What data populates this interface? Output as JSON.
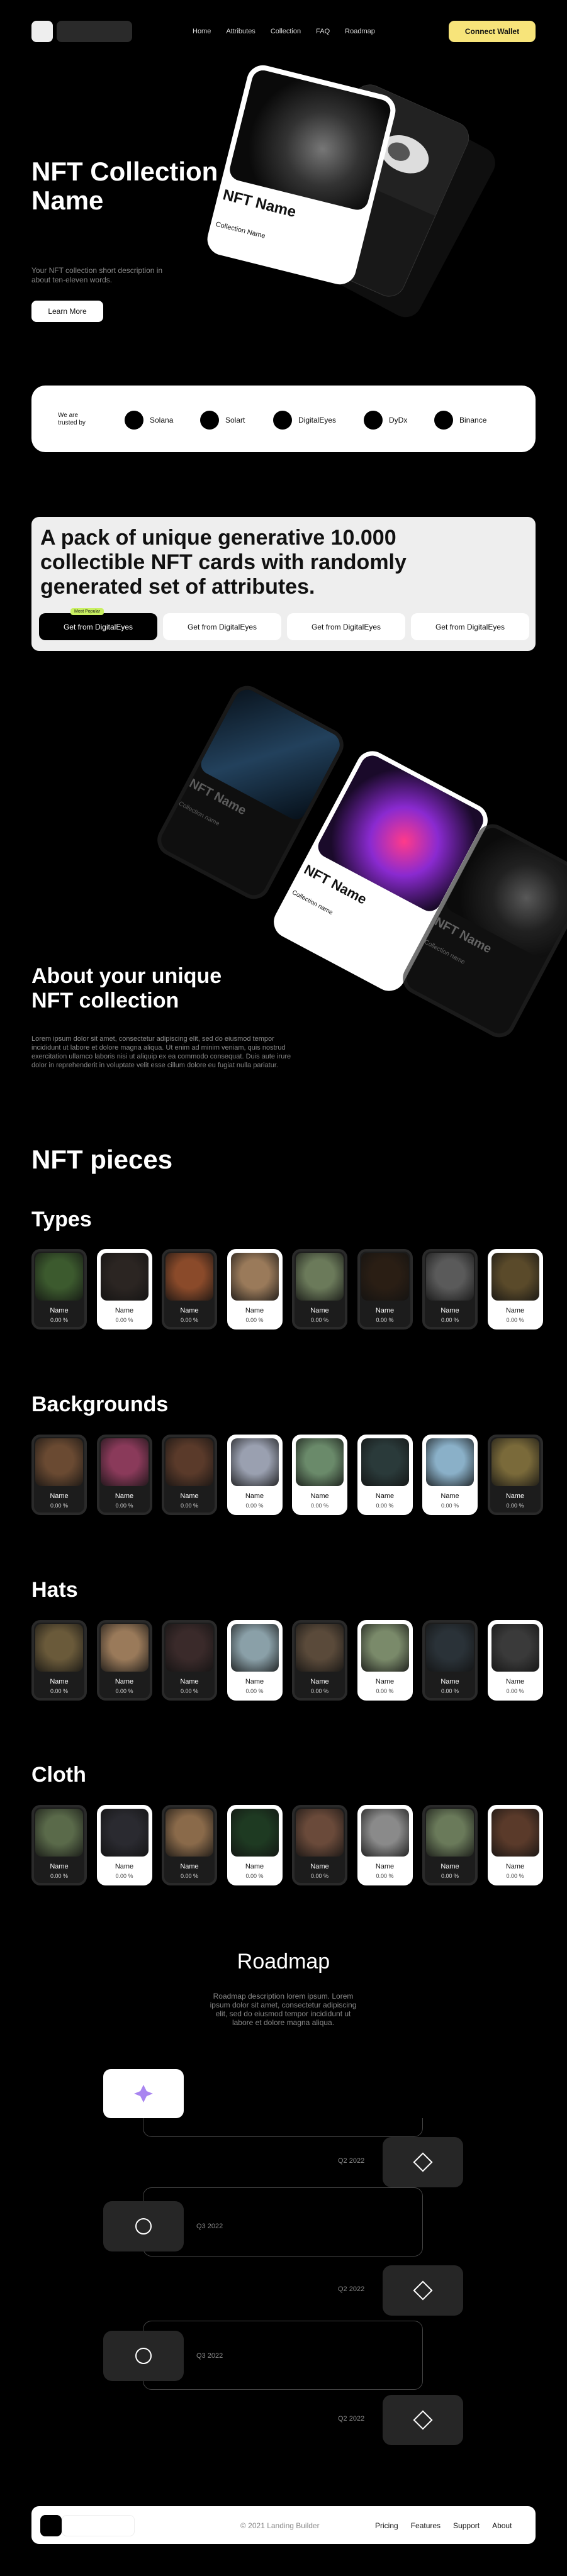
{
  "header": {
    "nav": [
      "Home",
      "Attributes",
      "Collection",
      "FAQ",
      "Roadmap"
    ],
    "connect_label": "Connect Wallet"
  },
  "hero": {
    "title": "NFT Collection Name",
    "description": "Your NFT collection short description in about ten-eleven words.",
    "cta": "Learn More",
    "card_title": "NFT Name",
    "card_subtitle": "Collection Name"
  },
  "trusted": {
    "label": "We are trusted by",
    "partners": [
      "Solana",
      "Solart",
      "DigitalEyes",
      "DyDx",
      "Binance"
    ]
  },
  "pack": {
    "title": "A pack of unique generative 10.000 collectible NFT cards with randomly generated set of attributes.",
    "badge": "Most Popular",
    "buttons": [
      "Get from DigitalEyes",
      "Get from DigitalEyes",
      "Get from DigitalEyes",
      "Get from DigitalEyes"
    ]
  },
  "showcase": {
    "card_title": "NFT Name",
    "card_subtitle": "Collection name"
  },
  "about": {
    "title": "About your unique NFT collection",
    "description": "Lorem ipsum dolor sit amet, consectetur adipiscing elit, sed do eiusmod tempor incididunt ut labore et dolore magna aliqua. Ut enim ad minim veniam, quis nostrud exercitation ullamco laboris nisi ut aliquip ex ea commodo consequat. Duis aute irure dolor in reprehenderit in voluptate velit esse cillum dolore eu fugiat nulla pariatur."
  },
  "pieces": {
    "title": "NFT pieces",
    "tile_name": "Name",
    "tile_pct": "0.00 %",
    "categories": [
      {
        "name": "Types",
        "tiles": [
          {
            "light": false,
            "color": "#3c5a2e"
          },
          {
            "light": true,
            "color": "#2b2522"
          },
          {
            "light": false,
            "color": "#8a4a2a"
          },
          {
            "light": true,
            "color": "#9a7a5a"
          },
          {
            "light": false,
            "color": "#6b7a5a"
          },
          {
            "light": false,
            "color": "#2a1e14"
          },
          {
            "light": false,
            "color": "#5a5a5a"
          },
          {
            "light": true,
            "color": "#5a4a2a"
          }
        ]
      },
      {
        "name": "Backgrounds",
        "tiles": [
          {
            "light": false,
            "color": "#6a4a32"
          },
          {
            "light": false,
            "color": "#8a3a5a"
          },
          {
            "light": false,
            "color": "#5a3a2a"
          },
          {
            "light": true,
            "color": "#9aa0b0"
          },
          {
            "light": true,
            "color": "#6a8a6a"
          },
          {
            "light": true,
            "color": "#2a3a3a"
          },
          {
            "light": true,
            "color": "#8ab0c8"
          },
          {
            "light": false,
            "color": "#7a6a3a"
          }
        ]
      },
      {
        "name": "Hats",
        "tiles": [
          {
            "light": false,
            "color": "#6a5a3a"
          },
          {
            "light": false,
            "color": "#9a7a5a"
          },
          {
            "light": false,
            "color": "#3a2a2a"
          },
          {
            "light": true,
            "color": "#8aa0a8"
          },
          {
            "light": false,
            "color": "#5a4a3a"
          },
          {
            "light": true,
            "color": "#7a8a6a"
          },
          {
            "light": false,
            "color": "#2a3238"
          },
          {
            "light": true,
            "color": "#3a3a3a"
          }
        ]
      },
      {
        "name": "Cloth",
        "tiles": [
          {
            "light": false,
            "color": "#5a6a4a"
          },
          {
            "light": true,
            "color": "#2a2a30"
          },
          {
            "light": false,
            "color": "#8a6a4a"
          },
          {
            "light": true,
            "color": "#1e3a22"
          },
          {
            "light": false,
            "color": "#6a4a3a"
          },
          {
            "light": true,
            "color": "#8a8a8a"
          },
          {
            "light": false,
            "color": "#6a7a5a"
          },
          {
            "light": true,
            "color": "#5a3a2a"
          }
        ]
      }
    ]
  },
  "roadmap": {
    "title": "Roadmap",
    "description": "Roadmap description lorem ipsum. Lorem ipsum dolor sit amet, consectetur adipiscing elit, sed do eiusmod tempor incididunt ut labore et dolore magna aliqua.",
    "dates": [
      "Q2 2022",
      "Q3 2022",
      "Q2 2022",
      "Q3 2022",
      "Q2 2022"
    ]
  },
  "footer": {
    "copyright": "© 2021 Landing Builder",
    "links": [
      "Pricing",
      "Features",
      "Support",
      "About"
    ]
  },
  "colors": {
    "accent_yellow": "#f7e47a",
    "badge_green": "#c9f062",
    "star_purple": "#a985f0"
  }
}
